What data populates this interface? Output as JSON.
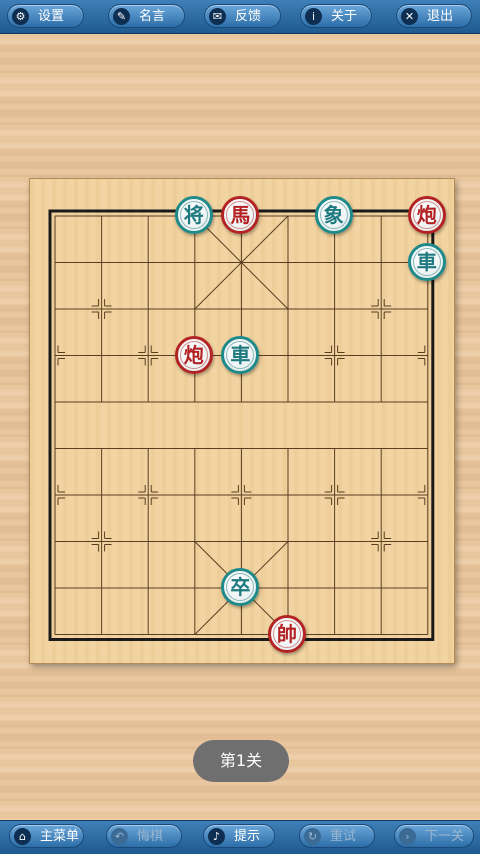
{
  "top_menu": [
    {
      "key": "settings",
      "label": "设置",
      "icon": "gear-icon",
      "glyph": "⚙"
    },
    {
      "key": "quotes",
      "label": "名言",
      "icon": "speech-bubble-icon",
      "glyph": "✎"
    },
    {
      "key": "feedback",
      "label": "反馈",
      "icon": "envelope-icon",
      "glyph": "✉"
    },
    {
      "key": "about",
      "label": "关于",
      "icon": "info-icon",
      "glyph": "i"
    },
    {
      "key": "exit",
      "label": "退出",
      "icon": "close-icon",
      "glyph": "✕"
    }
  ],
  "bottom_menu": [
    {
      "key": "main_menu",
      "label": "主菜单",
      "icon": "home-icon",
      "glyph": "⌂",
      "enabled": true
    },
    {
      "key": "undo",
      "label": "悔棋",
      "icon": "undo-icon",
      "glyph": "↶",
      "enabled": false
    },
    {
      "key": "hint",
      "label": "提示",
      "icon": "bell-icon",
      "glyph": "♪",
      "enabled": true
    },
    {
      "key": "retry",
      "label": "重试",
      "icon": "refresh-icon",
      "glyph": "↻",
      "enabled": false
    },
    {
      "key": "next",
      "label": "下一关",
      "icon": "arrow-right-icon",
      "glyph": "›",
      "enabled": false
    }
  ],
  "board": {
    "files": 9,
    "ranks": 10
  },
  "pieces": [
    {
      "char": "将",
      "side": "green",
      "file": 3,
      "rank": 0
    },
    {
      "char": "馬",
      "side": "red",
      "file": 4,
      "rank": 0
    },
    {
      "char": "象",
      "side": "green",
      "file": 6,
      "rank": 0
    },
    {
      "char": "炮",
      "side": "red",
      "file": 8,
      "rank": 0
    },
    {
      "char": "車",
      "side": "green",
      "file": 8,
      "rank": 1
    },
    {
      "char": "炮",
      "side": "red",
      "file": 3,
      "rank": 3
    },
    {
      "char": "車",
      "side": "green",
      "file": 4,
      "rank": 3
    },
    {
      "char": "卒",
      "side": "green",
      "file": 4,
      "rank": 8
    },
    {
      "char": "帥",
      "side": "red",
      "file": 5,
      "rank": 9
    }
  ],
  "level_label": "第1关",
  "colors": {
    "red": "#b42323",
    "green": "#1e8a8a",
    "bar": "#2d6ea8"
  }
}
